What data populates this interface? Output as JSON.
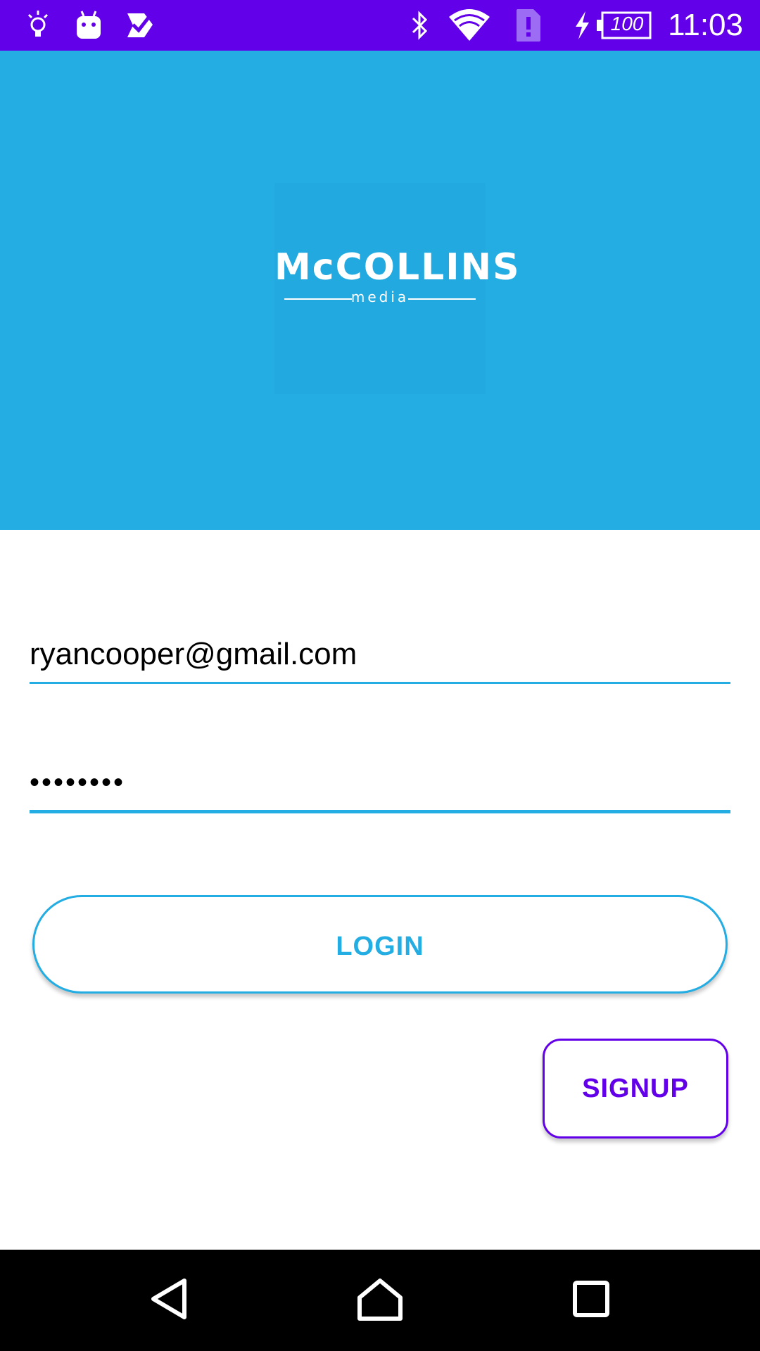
{
  "status_bar": {
    "time": "11:03",
    "battery_level": "100",
    "notification_icons": [
      "lightbulb-icon",
      "android-icon",
      "check-badge-icon"
    ],
    "system_icons": [
      "bluetooth-icon",
      "wifi-icon",
      "sim-alert-icon",
      "charging-icon",
      "battery-icon"
    ],
    "background_color": "#6200EA"
  },
  "hero": {
    "background_color": "#23ADE3",
    "logo": {
      "title": "McCOLLINS",
      "subtitle": "media"
    }
  },
  "form": {
    "email": {
      "value": "ryancooper@gmail.com",
      "placeholder": ""
    },
    "password": {
      "value": "••••••••",
      "placeholder": ""
    },
    "login_label": "LOGIN",
    "signup_label": "SIGNUP",
    "accent_color": "#23ADE3",
    "secondary_color": "#6200EA"
  },
  "nav_bar": {
    "buttons": [
      "back-icon",
      "home-icon",
      "recents-icon"
    ]
  }
}
